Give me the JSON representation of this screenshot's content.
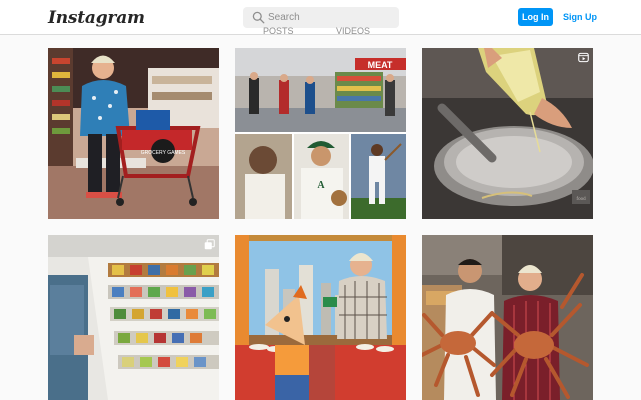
{
  "header": {
    "logo_text": "Instagram",
    "search_placeholder": "Search",
    "login_label": "Log In",
    "signup_label": "Sign Up"
  },
  "profile_tabs": [
    {
      "label": "POSTS"
    },
    {
      "label": "VIDEOS"
    }
  ],
  "posts": [
    {
      "caption": "",
      "badge": "none",
      "overlay_text": "GROCERY GAMES"
    },
    {
      "caption": "",
      "badge": "none",
      "overlay_text": "MEAT"
    },
    {
      "caption": "",
      "badge": "reel-icon",
      "overlay_text": "food"
    },
    {
      "caption": "",
      "badge": "carousel-icon",
      "overlay_text": ""
    },
    {
      "caption": "",
      "badge": "none",
      "overlay_text": ""
    },
    {
      "caption": "",
      "badge": "none",
      "overlay_text": ""
    }
  ],
  "colors": {
    "accent": "#0095f6",
    "background": "#fafafa",
    "border": "#dbdbdb",
    "text": "#262626",
    "muted": "#8e8e8e"
  }
}
